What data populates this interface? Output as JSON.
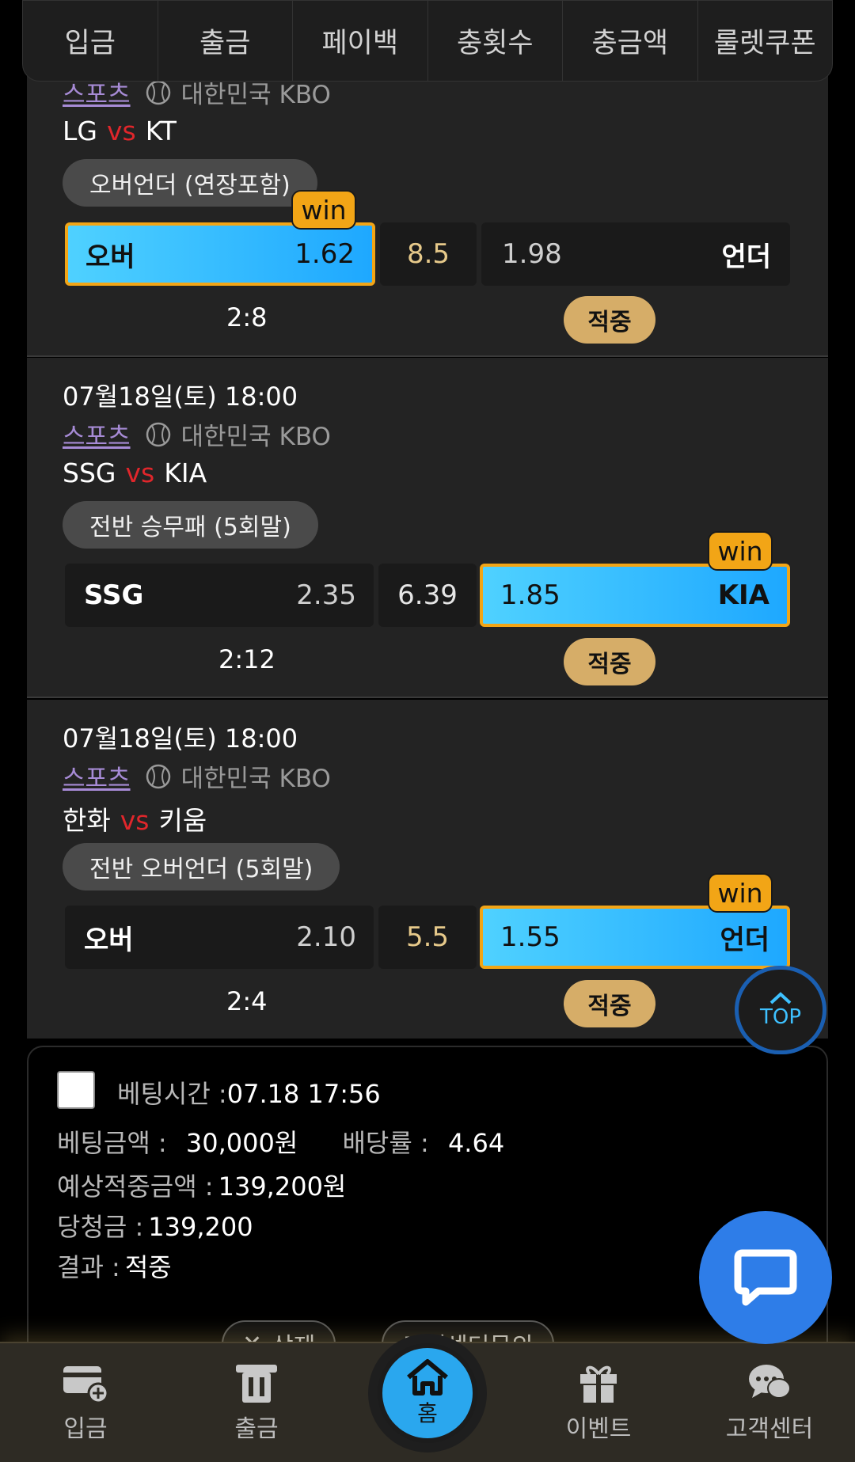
{
  "top_tabs": [
    "입금",
    "출금",
    "페이백",
    "충횟수",
    "충금액",
    "룰렛쿠폰"
  ],
  "cards": [
    {
      "date": "",
      "category": "스포츠",
      "league": "대한민국 KBO",
      "home": "LG",
      "vs": "vs",
      "away": "KT",
      "market": "오버언더 (연장포함)",
      "left_label": "오버",
      "left_odd": "1.62",
      "center": "8.5",
      "right_odd": "1.98",
      "right_label": "언더",
      "selected": "left",
      "win": "win",
      "score": "2:8",
      "result": "적중"
    },
    {
      "date": "07월18일(토) 18:00",
      "category": "스포츠",
      "league": "대한민국 KBO",
      "home": "SSG",
      "vs": "vs",
      "away": "KIA",
      "market": "전반 승무패 (5회말)",
      "left_label": "SSG",
      "left_odd": "2.35",
      "center": "6.39",
      "right_odd": "1.85",
      "right_label": "KIA",
      "selected": "right",
      "win": "win",
      "score": "2:12",
      "result": "적중"
    },
    {
      "date": "07월18일(토) 18:00",
      "category": "스포츠",
      "league": "대한민국 KBO",
      "home": "한화",
      "vs": "vs",
      "away": "키움",
      "market": "전반 오버언더 (5회말)",
      "left_label": "오버",
      "left_odd": "2.10",
      "center": "5.5",
      "right_odd": "1.55",
      "right_label": "언더",
      "selected": "right",
      "win": "win",
      "score": "2:4",
      "result": "적중"
    }
  ],
  "summary": {
    "bet_time_label": "베팅시간 :",
    "bet_time": "07.18 17:56",
    "amount_label": "베팅금액 :",
    "amount": "30,000원",
    "rate_label": "배당률 :",
    "rate": "4.64",
    "expected_label": "예상적중금액 :",
    "expected": "139,200원",
    "prize_label": "당청금 :",
    "prize": "139,200",
    "result_label": "결과 :",
    "result": "적중",
    "delete_btn": "삭제",
    "cs_btn": "고객센터문의"
  },
  "top_button": "TOP",
  "bottom_nav": {
    "deposit": "입금",
    "withdraw": "출금",
    "home": "홈",
    "event": "이벤트",
    "support": "고객센터"
  },
  "colors": {
    "accent_blue": "#1ea8ff",
    "win_orange": "#f2a516",
    "hit_gold": "#d6ad68",
    "vs_red": "#e0262b"
  }
}
